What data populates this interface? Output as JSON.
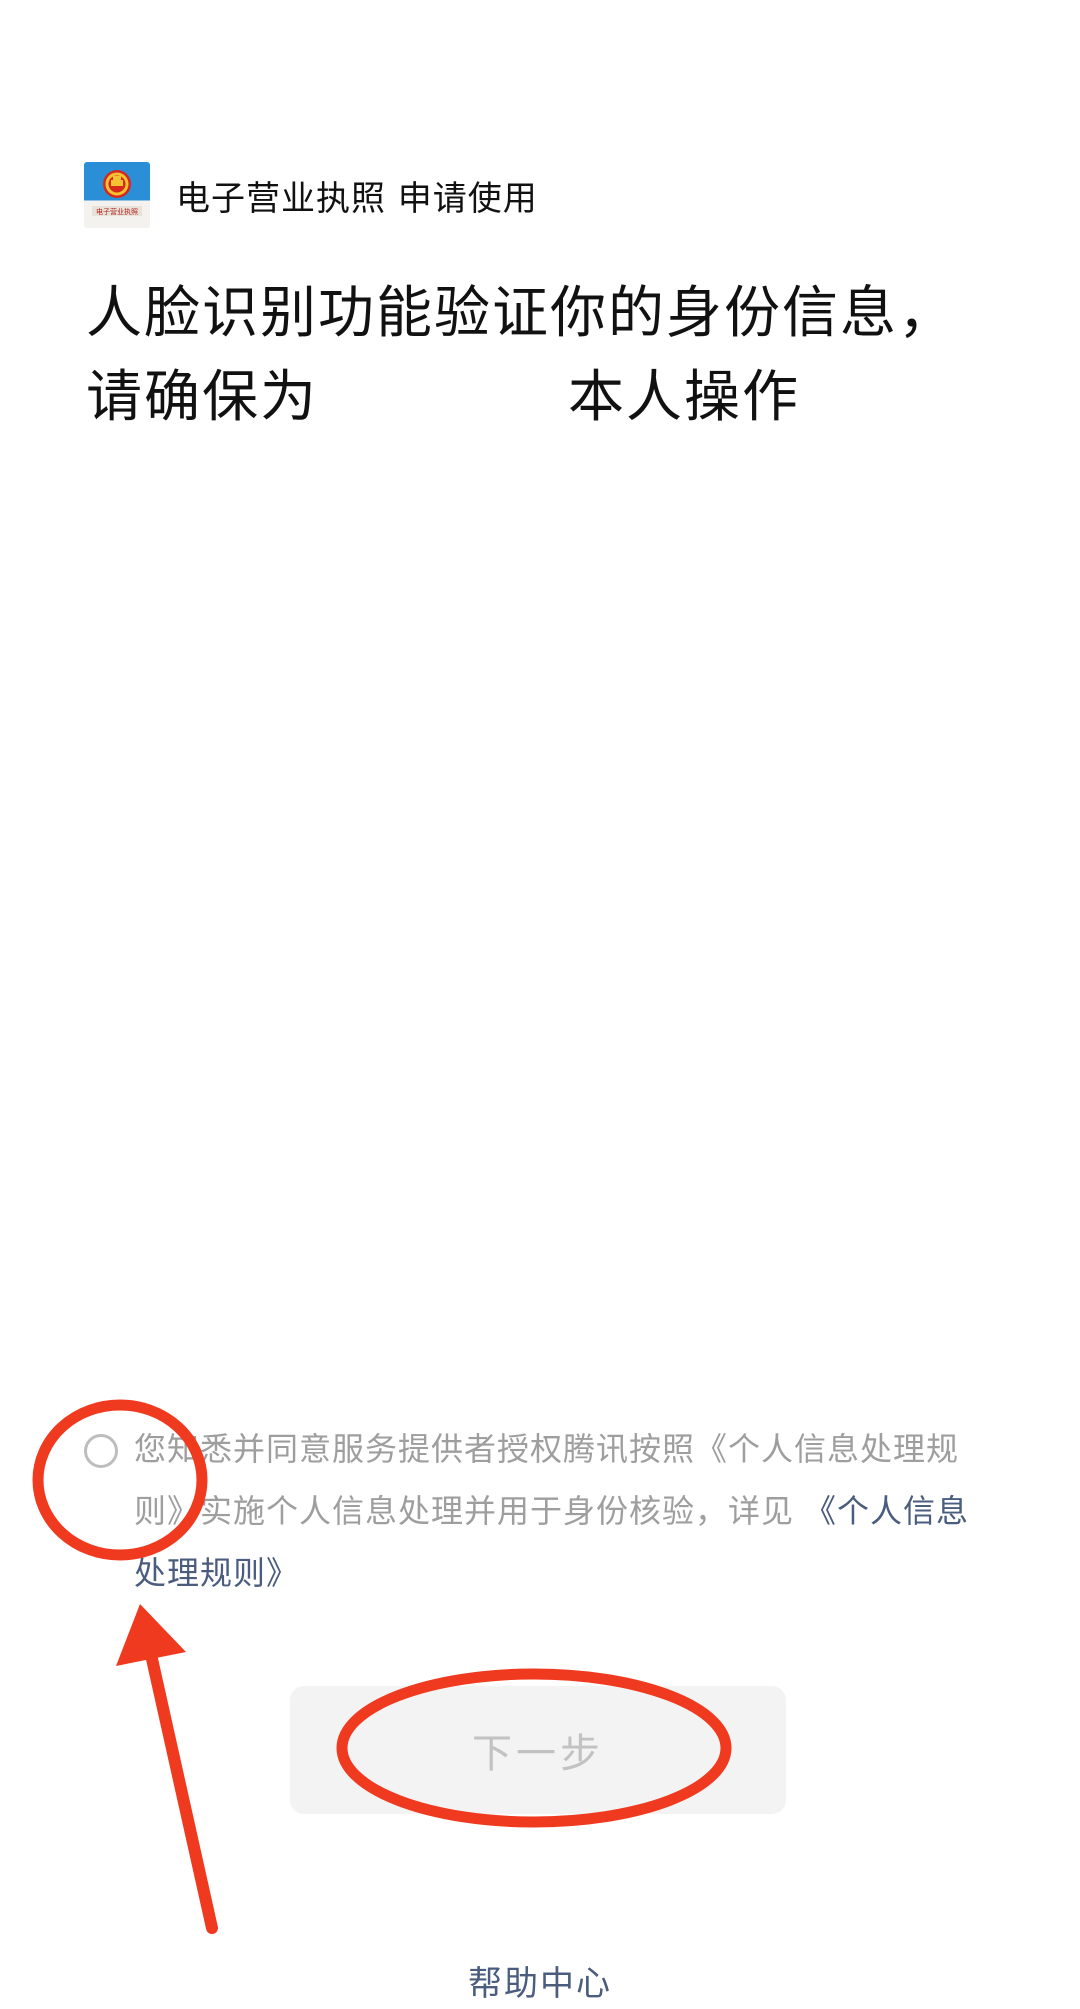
{
  "header": {
    "app_name": "电子营业执照 申请使用",
    "logo_icon": "national-emblem-icon",
    "logo_caption": "电子营业执照"
  },
  "headline": {
    "line1": "人脸识别功能验证你的身份信息，",
    "line2_prefix": "请确保为",
    "line2_suffix": "本人操作"
  },
  "consent": {
    "text": "您知悉并同意服务提供者授权腾讯按照《个人信息处理规则》实施个人信息处理并用于身份核验，详见",
    "link_label": "《个人信息处理规则》",
    "checked": false
  },
  "actions": {
    "next_label": "下一步",
    "next_enabled": false
  },
  "footer": {
    "help_label": "帮助中心"
  },
  "colors": {
    "link": "#4a5d7e",
    "annotation_red": "#f03a1f",
    "logo_blue": "#2b8fd8"
  }
}
